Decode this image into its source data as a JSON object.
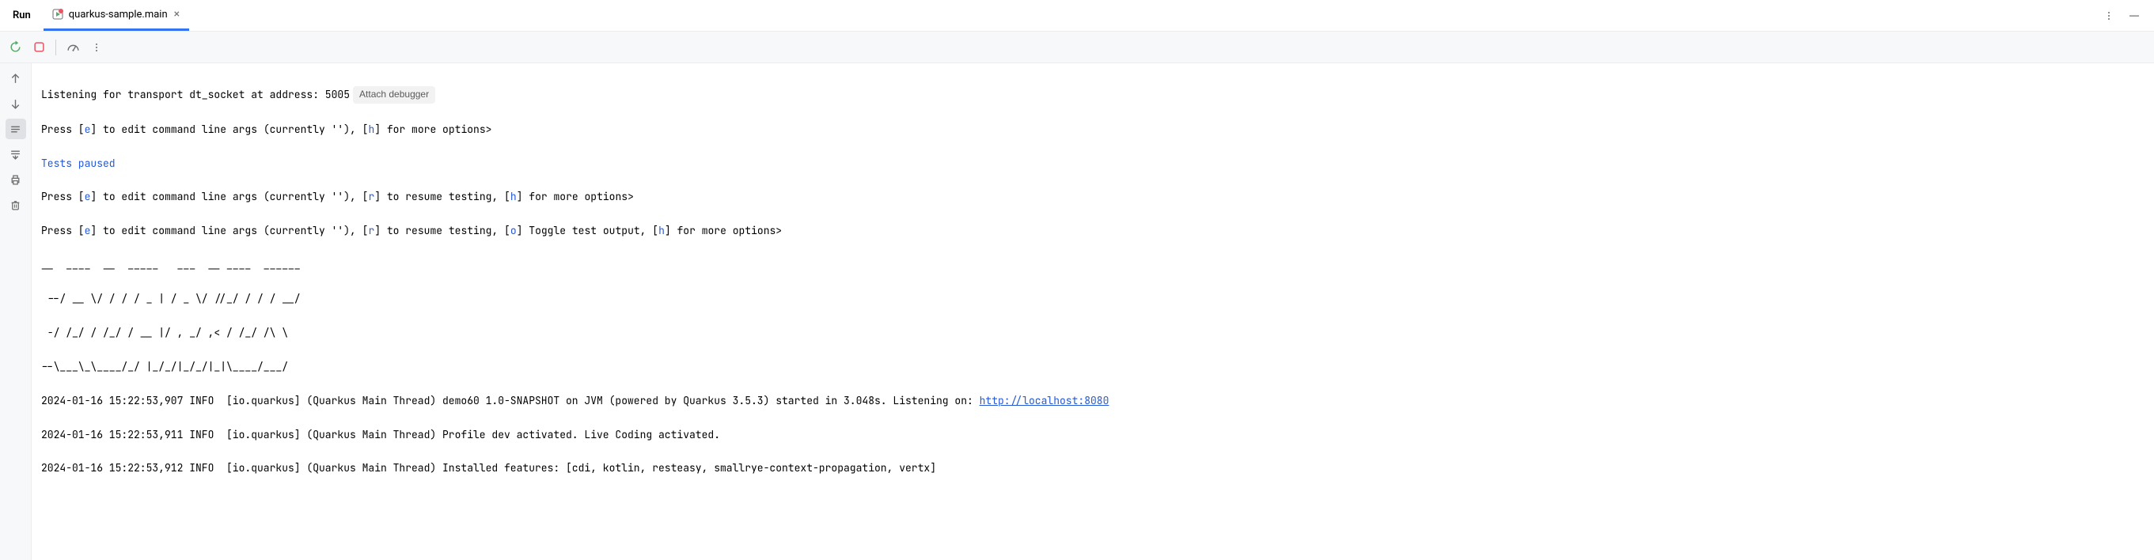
{
  "header": {
    "title": "Run",
    "tab": {
      "label": "quarkus-sample.main"
    }
  },
  "console": {
    "listening": "Listening for transport dt_socket at address: 5005",
    "attach_label": "Attach debugger",
    "press1_a": "Press [",
    "press1_key_e": "e",
    "press1_b": "] to edit command line args (currently ''), [",
    "press1_key_h": "h",
    "press1_c": "] for more options>",
    "tests_paused": "Tests paused",
    "press2_a": "Press [",
    "press2_key_e": "e",
    "press2_b": "] to edit command line args (currently ''), [",
    "press2_key_r": "r",
    "press2_c": "] to resume testing, [",
    "press2_key_h": "h",
    "press2_d": "] for more options>",
    "press3_a": "Press [",
    "press3_key_e": "e",
    "press3_b": "] to edit command line args (currently ''), [",
    "press3_key_r": "r",
    "press3_c": "] to resume testing, [",
    "press3_key_o": "o",
    "press3_d": "] Toggle test output, [",
    "press3_key_h": "h",
    "press3_e": "] for more options>",
    "ascii1": "__  ____  __  _____   ___  __ ____  ______ ",
    "ascii2": " --/ __ \\/ / / / _ | / _ \\/ //_/ / / / __/ ",
    "ascii3": " -/ /_/ / /_/ / __ |/ , _/ ,< / /_/ /\\ \\   ",
    "ascii4": "--\\___\\_\\____/_/ |_/_/|_/_/|_|\\____/___/   ",
    "log1_a": "2024-01-16 15:22:53,907 INFO  [io.quarkus] (Quarkus Main Thread) demo60 1.0-SNAPSHOT on JVM (powered by Quarkus 3.5.3) started in 3.048s. Listening on: ",
    "log1_url": "http://localhost:8080",
    "log2": "2024-01-16 15:22:53,911 INFO  [io.quarkus] (Quarkus Main Thread) Profile dev activated. Live Coding activated.",
    "log3": "2024-01-16 15:22:53,912 INFO  [io.quarkus] (Quarkus Main Thread) Installed features: [cdi, kotlin, resteasy, smallrye-context-propagation, vertx]"
  }
}
